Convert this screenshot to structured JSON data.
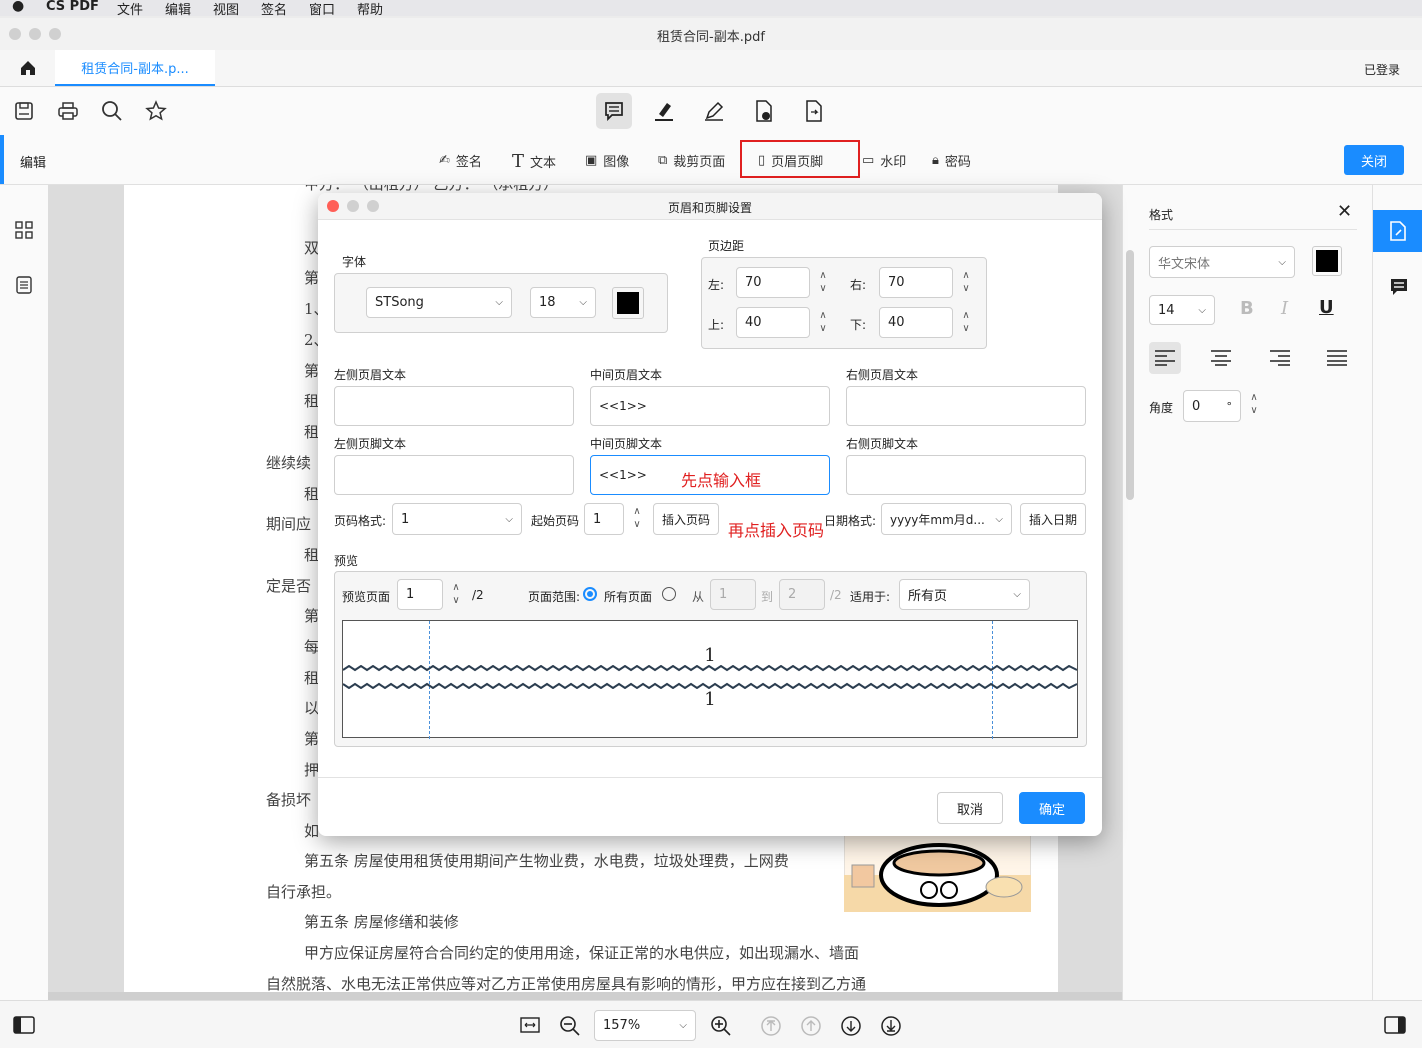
{
  "menubar": {
    "app": "CS PDF",
    "items": [
      "文件",
      "编辑",
      "视图",
      "签名",
      "窗口",
      "帮助"
    ]
  },
  "window": {
    "title": "租赁合同-副本.pdf"
  },
  "tabbar": {
    "tab": "租赁合同-副本.p...",
    "login": "已登录"
  },
  "editbar": {
    "label": "编辑",
    "items": [
      "签名",
      "文本",
      "图像",
      "裁剪页面",
      "页眉页脚",
      "水印",
      "密码"
    ],
    "close": "关闭"
  },
  "document": {
    "lines": [
      "甲方：                  （出租方）                          乙方：                  （承租方）",
      "双",
      "第",
      "1、",
      "2、",
      "第",
      "租",
      "租",
      "继续续",
      "租",
      "期间应",
      "租",
      "定是否",
      "第",
      "每",
      "租",
      "以",
      "第",
      "押",
      "备损坏",
      "如",
      "第五条  房屋使用租赁使用期间产生物业费，水电费，垃圾处理费，上网费",
      "自行承担。",
      "第五条  房屋修缮和装修",
      "甲方应保证房屋符合合同约定的使用用途，保证正常的水电供应，如出现漏水、墙面",
      "自然脱落、水电无法正常供应等对乙方正常使用房屋具有影响的情形，甲方应在接到乙方通"
    ]
  },
  "dialog": {
    "title": "页眉和页脚设置",
    "font": {
      "label": "字体",
      "family": "STSong",
      "size": "18",
      "color": "#000000"
    },
    "margins": {
      "label": "页边距",
      "left_label": "左:",
      "left": "70",
      "right_label": "右:",
      "right": "70",
      "top_label": "上:",
      "top": "40",
      "bottom_label": "下:",
      "bottom": "40"
    },
    "header": {
      "left_label": "左侧页眉文本",
      "center_label": "中间页眉文本",
      "right_label": "右侧页眉文本",
      "left": "",
      "center": "<<1>>",
      "right": ""
    },
    "footer": {
      "left_label": "左侧页脚文本",
      "center_label": "中间页脚文本",
      "right_label": "右侧页脚文本",
      "left": "",
      "center": "<<1>>",
      "right": ""
    },
    "annotation1": "先点输入框",
    "annotation2": "再点插入页码",
    "page_format_label": "页码格式:",
    "page_format": "1",
    "start_page_label": "起始页码",
    "start_page": "1",
    "insert_page": "插入页码",
    "date_format_label": "日期格式:",
    "date_format": "yyyy年mm月d...",
    "insert_date": "插入日期",
    "preview": {
      "label": "预览",
      "page_label": "预览页面",
      "page": "1",
      "total": "/2",
      "range_label": "页面范围:",
      "all_pages": "所有页面",
      "from_label": "从",
      "from": "1",
      "to_label": "到",
      "to": "2",
      "to_total": "/2",
      "apply_label": "适用于:",
      "apply": "所有页",
      "header_number": "1",
      "footer_number": "1"
    },
    "cancel": "取消",
    "ok": "确定"
  },
  "format_panel": {
    "title": "格式",
    "font": "华文宋体",
    "size": "14",
    "color": "#000000",
    "bold": "B",
    "italic": "I",
    "underline": "U",
    "angle_label": "角度",
    "angle": "0",
    "degree": "°"
  },
  "bottombar": {
    "zoom": "157%"
  },
  "colors": {
    "accent": "#1a8cff",
    "highlight_border": "#e02020",
    "annotation": "#e02020"
  }
}
